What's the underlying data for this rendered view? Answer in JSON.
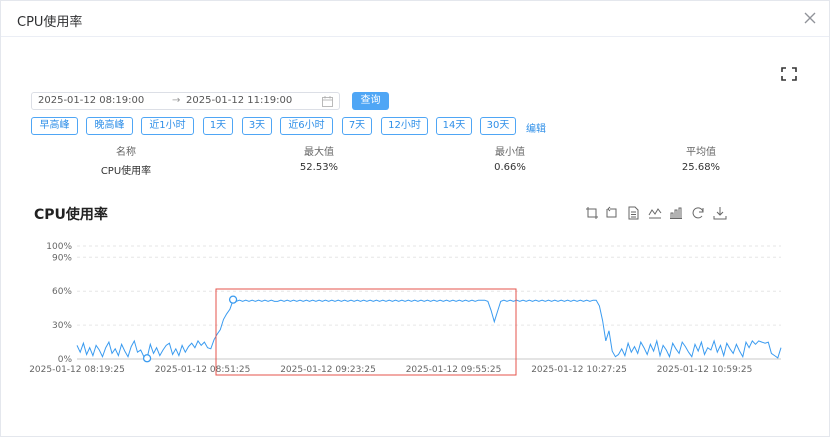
{
  "dialog": {
    "title": "CPU使用率"
  },
  "date_range": {
    "start": "2025-01-12 08:19:00",
    "separator": "→",
    "end": "2025-01-12 11:19:00"
  },
  "query_button": "查询",
  "quick_ranges": [
    "早高峰",
    "晚高峰",
    "近1小时",
    "1天",
    "3天",
    "近6小时",
    "7天",
    "12小时",
    "14天",
    "30天"
  ],
  "edit_link": "编辑",
  "stats": {
    "headers": [
      "名称",
      "最大值",
      "最小值",
      "平均值"
    ],
    "row": [
      "CPU使用率",
      "52.53%",
      "0.66%",
      "25.68%"
    ]
  },
  "chart_title": "CPU使用率",
  "toolbox_icons": [
    "zoom-select-icon",
    "zoom-reset-icon",
    "data-view-icon",
    "line-switch-icon",
    "bar-switch-icon",
    "restore-icon",
    "save-image-icon"
  ],
  "colors": {
    "accent": "#4fa6f5",
    "series": "#3a9bf0",
    "highlight_box": "#e5534b"
  },
  "chart_data": {
    "type": "line",
    "title": "CPU使用率",
    "xlabel": "",
    "ylabel": "",
    "x_ticks": [
      "2025-01-12 08:19:25",
      "2025-01-12 08:51:25",
      "2025-01-12 09:23:25",
      "2025-01-12 09:55:25",
      "2025-01-12 10:27:25",
      "2025-01-12 10:59:25"
    ],
    "y_ticks": [
      "0%",
      "30%",
      "60%",
      "90%",
      "100%"
    ],
    "ylim": [
      0,
      100
    ],
    "grid": true,
    "legend": "none",
    "series": [
      {
        "values": [
          12,
          6,
          14,
          4,
          10,
          3,
          12,
          8,
          2,
          10,
          15,
          5,
          9,
          3,
          13,
          7,
          2,
          11,
          16,
          6,
          8,
          2,
          1,
          13,
          5,
          10,
          3,
          8,
          12,
          14,
          4,
          9,
          3,
          12,
          6,
          11,
          14,
          10,
          16,
          12,
          15,
          10,
          9,
          17,
          22,
          26,
          35,
          40,
          44,
          52,
          51,
          52,
          51,
          52,
          51,
          52,
          51,
          52,
          51,
          52,
          51,
          52,
          51,
          51,
          52,
          51,
          52,
          51,
          52,
          51,
          52,
          51,
          52,
          51,
          52,
          51,
          52,
          51,
          52,
          51,
          52,
          51,
          52,
          51,
          52,
          51,
          52,
          51,
          52,
          51,
          52,
          51,
          52,
          51,
          52,
          51,
          52,
          51,
          52,
          51,
          52,
          51,
          52,
          51,
          52,
          51,
          52,
          51,
          52,
          51,
          52,
          51,
          52,
          51,
          52,
          51,
          52,
          51,
          52,
          51,
          52,
          51,
          52,
          51,
          52,
          51,
          52,
          52,
          52,
          51,
          43,
          33,
          42,
          51,
          52,
          51,
          52,
          51,
          52,
          51,
          52,
          51,
          52,
          51,
          52,
          51,
          52,
          51,
          52,
          51,
          52,
          51,
          52,
          51,
          52,
          51,
          52,
          51,
          52,
          51,
          52,
          51,
          52,
          52,
          47,
          34,
          16,
          25,
          7,
          2,
          4,
          9,
          3,
          14,
          6,
          11,
          5,
          15,
          10,
          4,
          13,
          7,
          16,
          3,
          12,
          8,
          2,
          14,
          9,
          5,
          15,
          11,
          6,
          2,
          13,
          7,
          15,
          4,
          10,
          8,
          16,
          6,
          12,
          3,
          14,
          9,
          5,
          13,
          7,
          2,
          15,
          10,
          16,
          13,
          16,
          15,
          14,
          15,
          5,
          3,
          1,
          10
        ]
      }
    ],
    "markers": [
      {
        "label": "min",
        "x_index": 22,
        "value": 0.66
      },
      {
        "label": "max",
        "x_index": 49,
        "value": 52.53
      }
    ]
  }
}
